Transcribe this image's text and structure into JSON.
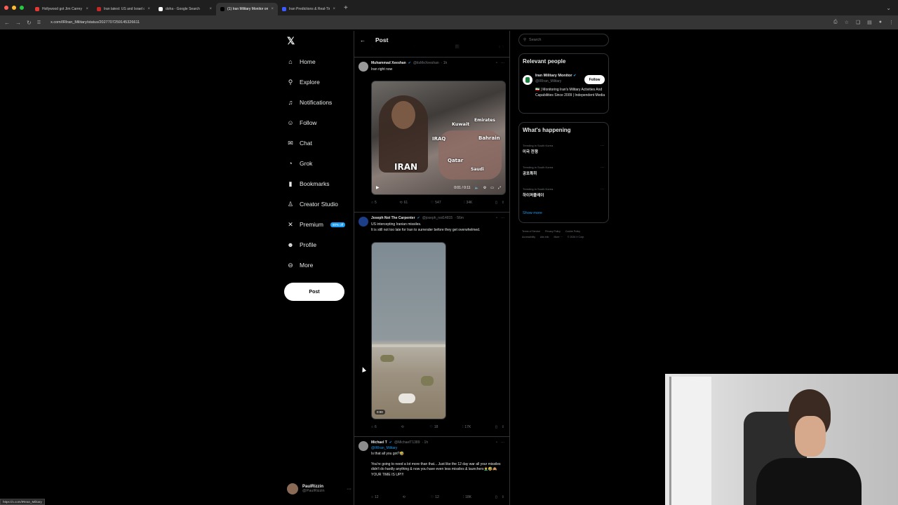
{
  "browser": {
    "tabs": [
      {
        "title": "Hollywood got Jim Carrey 😭",
        "favicon_color": "#e53935",
        "active": false
      },
      {
        "title": "Iran latest: US and Israel con",
        "favicon_color": "#c62828",
        "active": false
      },
      {
        "title": "doha - Google Search",
        "favicon_color": "#ffffff",
        "active": false
      },
      {
        "title": "(1) Iran Military Monitor on X",
        "favicon_color": "#000000",
        "active": true
      },
      {
        "title": "Iran Predictions & Real-Time",
        "favicon_color": "#3d5afe",
        "active": false
      }
    ],
    "url": "x.com/IRIran_Military/status/2027707259145326611",
    "status_url": "https://x.com/IRIran_Military"
  },
  "nav": {
    "logo": "𝕏",
    "items": [
      {
        "label": "Home",
        "icon": "home-icon",
        "glyph": "⌂"
      },
      {
        "label": "Explore",
        "icon": "search-icon",
        "glyph": "⚲"
      },
      {
        "label": "Notifications",
        "icon": "bell-icon",
        "glyph": "♫"
      },
      {
        "label": "Follow",
        "icon": "person-add-icon",
        "glyph": "☺"
      },
      {
        "label": "Chat",
        "icon": "mail-icon",
        "glyph": "✉"
      },
      {
        "label": "Grok",
        "icon": "grok-icon",
        "glyph": "◔"
      },
      {
        "label": "Bookmarks",
        "icon": "bookmark-icon",
        "glyph": "▮"
      },
      {
        "label": "Creator Studio",
        "icon": "creator-studio-icon",
        "glyph": "♙"
      },
      {
        "label": "Premium",
        "icon": "x-premium-icon",
        "glyph": "✕",
        "badge": "80% off"
      },
      {
        "label": "Profile",
        "icon": "profile-icon",
        "glyph": "☻"
      },
      {
        "label": "More",
        "icon": "more-circle-icon",
        "glyph": "⊖"
      }
    ],
    "post_label": "Post",
    "account": {
      "name": "PaulRizzin",
      "handle": "@PaulRizzin"
    }
  },
  "main": {
    "header_title": "Post",
    "prev_actions": [
      "↻",
      "♡",
      "📊",
      "▮ ⇪"
    ],
    "tweets": [
      {
        "name": "Muhammad Xeeshan",
        "handle": "@itsMeXeeshan",
        "time": "· 1h",
        "lines": [
          "Iran right now"
        ],
        "video_time": "0:01 / 0:11",
        "overlay_labels": [
          "IRAN",
          "IRAQ",
          "Kuwait",
          "Emirates",
          "Bahrain",
          "Qatar",
          "Saudi"
        ],
        "actions": {
          "replies": "5",
          "reposts": "61",
          "likes": "547",
          "views": "34K"
        }
      },
      {
        "name": "Joseph Not The Carpenter",
        "handle": "@joseph_not14815",
        "time": "· 56m",
        "lines": [
          "US intercepting Iranian missiles.",
          "It is still not too late for Iran to surrender before they get overwhelmed."
        ],
        "video_time": "0:00",
        "actions": {
          "replies": "6",
          "reposts": "",
          "likes": "18",
          "views": "17K"
        }
      },
      {
        "name": "Michael T",
        "handle": "@MichaelT1389",
        "time": "· 1h",
        "mention": "@IRIran_Military",
        "lines": [
          "Is that all you got?🤣",
          "",
          "You're going to need a lot more than that... Just like the 12 day war all your missiles didn't do hardly anything & now you have even less missiles & launchers🤦‍♂️🤣🙈 YOUR TIME IS UP!!!"
        ],
        "actions": {
          "replies": "12",
          "reposts": "",
          "likes": "12",
          "views": "18K"
        }
      }
    ]
  },
  "right": {
    "search_placeholder": "Search",
    "relevant_title": "Relevant people",
    "person": {
      "name": "Iran Military Monitor",
      "handle": "@IRIran_Military",
      "bio": "🇮🇷 | Monitoring Iran's Military Activities And Capabilities Since 2009 | Independent Media",
      "follow_label": "Follow"
    },
    "happening_title": "What's happening",
    "trends": [
      {
        "context": "Trending in South Korea",
        "name": "미국 전쟁"
      },
      {
        "context": "Trending in South Korea",
        "name": "공포특히"
      },
      {
        "context": "Trending in South Korea",
        "name": "하이퍼플레이"
      }
    ],
    "show_more": "Show more",
    "footer": [
      "Terms of Service",
      "Privacy Policy",
      "Cookie Policy",
      "Accessibility",
      "Ads info",
      "More ···",
      "© 2026 X Corp."
    ]
  },
  "colors": {
    "accent": "#1d9bf0",
    "background": "#000000",
    "border": "#2f3336",
    "muted": "#71767b"
  }
}
